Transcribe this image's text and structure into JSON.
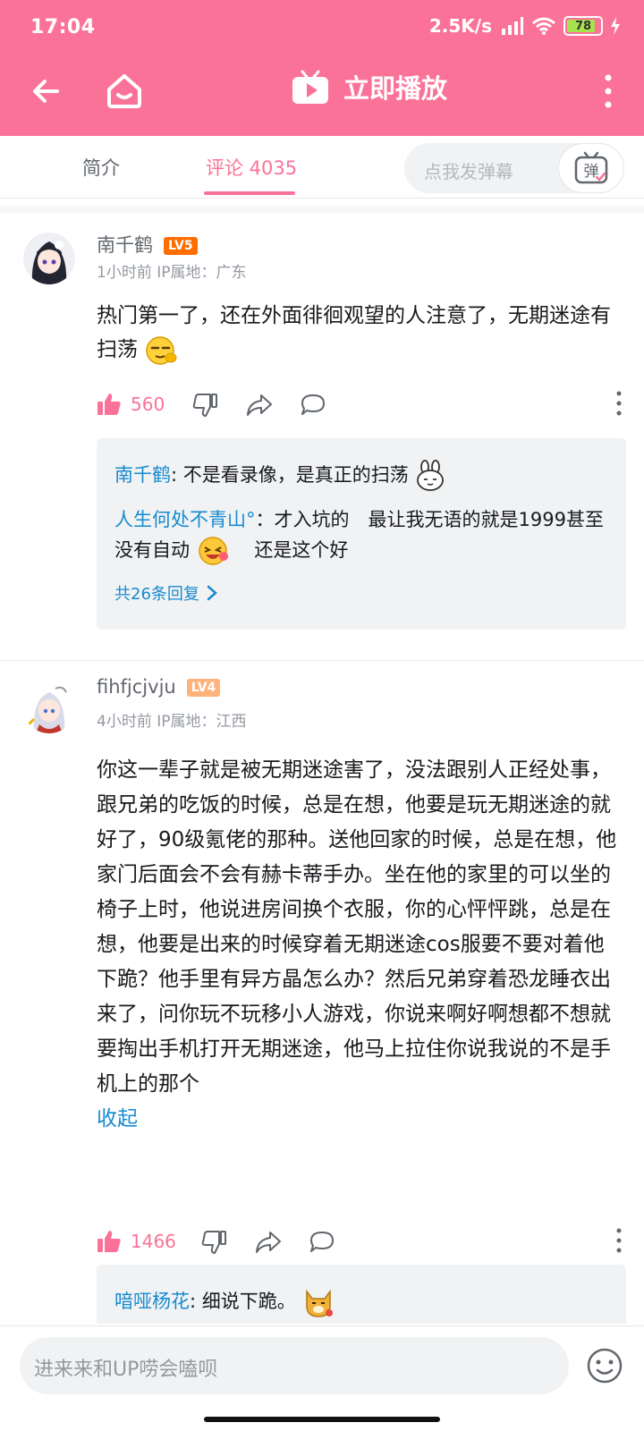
{
  "status": {
    "time": "17:04",
    "net_speed": "2.5K/s",
    "battery": "78",
    "colors": {
      "brand_pink": "#fb7299",
      "link_blue": "#178bcf"
    }
  },
  "header": {
    "play_label": "立即播放",
    "icons": [
      "back-arrow-icon",
      "home-icon",
      "tv-play-icon",
      "more-vertical-icon"
    ]
  },
  "tabs": {
    "intro": "简介",
    "comments": "评论 4035",
    "danmaku_placeholder": "点我发弹幕",
    "danmaku_button": "弹"
  },
  "comments": [
    {
      "user": "南千鹤",
      "level": "LV5",
      "time": "1小时前",
      "ip": "IP属地：广东",
      "text": "热门第一了，还在外面徘徊观望的人注意了，无期迷途有扫荡",
      "likes": "560",
      "replies": [
        {
          "user": "南千鹤",
          "sep": ": ",
          "text": "不是看录像，是真正的扫荡"
        },
        {
          "user": "人生何处不青山°",
          "sep": "：",
          "text": "才入坑的　最让我无语的就是1999甚至没有自动",
          "tail": "　还是这个好"
        }
      ],
      "reply_count": "共26条回复"
    },
    {
      "user": "fihfjcjvju",
      "level": "LV4",
      "time": "4小时前",
      "ip": "IP属地：江西",
      "text": "你这一辈子就是被无期迷途害了，没法跟别人正经处事，跟兄弟的吃饭的时候，总是在想，他要是玩无期迷途的就好了，90级氪佬的那种。送他回家的时候，总是在想，他家门后面会不会有赫卡蒂手办。坐在他的家里的可以坐的椅子上时，他说进房间换个衣服，你的心怦怦跳，总是在想，他要是出来的时候穿着无期迷途cos服要不要对着他下跪？他手里有异方晶怎么办？然后兄弟穿着恐龙睡衣出来了，问你玩不玩移小人游戏，你说来啊好啊想都不想就要掏出手机打开无期迷途，他马上拉住你说我说的不是手机上的那个",
      "collapse": "收起",
      "likes": "1466",
      "replies": [
        {
          "user": "喑哑杨花",
          "sep": ": ",
          "text": "细说下跪。"
        }
      ]
    }
  ],
  "bottom": {
    "input_placeholder": "进来来和UP唠会嗑呗"
  }
}
